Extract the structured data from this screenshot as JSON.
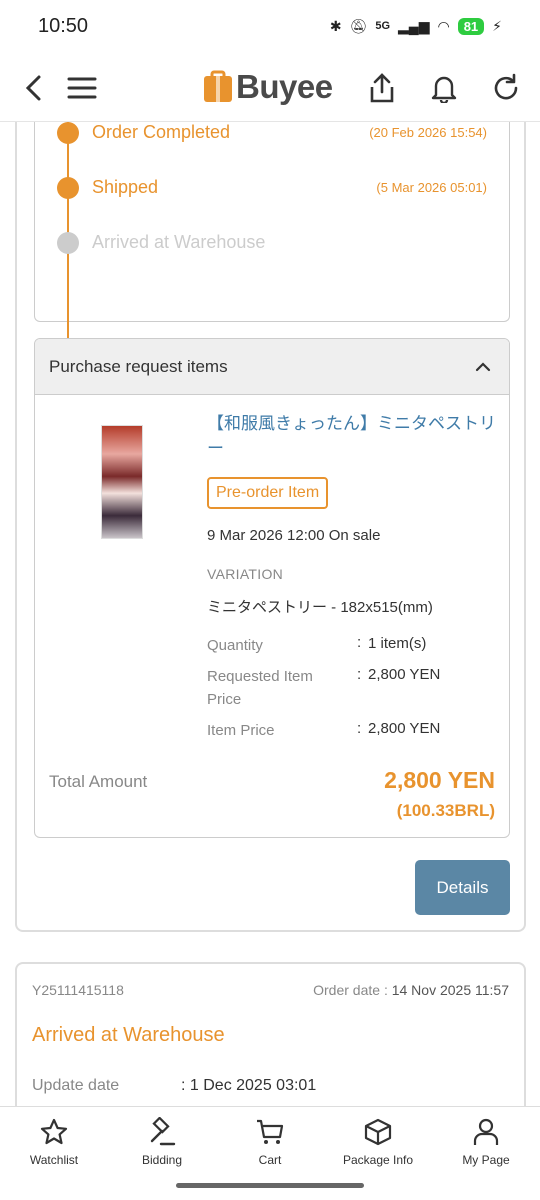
{
  "status": {
    "time": "10:50",
    "battery": "81",
    "network": "5G"
  },
  "header": {
    "logo_text": "Buyee"
  },
  "timeline": [
    {
      "label": "Order Completed",
      "date": "(20 Feb 2026 15:54)"
    },
    {
      "label": "Shipped",
      "date": "(5 Mar 2026 05:01)"
    },
    {
      "label": "Arrived at Warehouse",
      "date": ""
    }
  ],
  "purchase": {
    "heading": "Purchase request items",
    "item_title": "【和服風きょったん】ミニタペストリー",
    "badge": "Pre-order Item",
    "sale_date": "9 Mar 2026 12:00 On sale",
    "variation_label": "VARIATION",
    "variation_value": "ミニタペストリー - 182x515(mm)",
    "rows": [
      {
        "label": "Quantity",
        "colon": ":",
        "value": "1 item(s)"
      },
      {
        "label": "Requested Item Price",
        "colon": ":",
        "value": "2,800 YEN"
      },
      {
        "label": "Item Price",
        "colon": ":",
        "value": "2,800 YEN"
      }
    ],
    "total_label": "Total Amount",
    "total_yen": "2,800 YEN",
    "total_brl": "(100.33BRL)"
  },
  "details_button": "Details",
  "order2": {
    "id": "Y25111415118",
    "order_date_label": "Order date",
    "order_date_sep": ":",
    "order_date": "14 Nov 2025 11:57",
    "status": "Arrived at Warehouse",
    "update_label": "Update date",
    "update_value": ":  1 Dec 2025 03:01"
  },
  "nav": [
    {
      "label": "Watchlist",
      "icon": "star-icon"
    },
    {
      "label": "Bidding",
      "icon": "gavel-icon"
    },
    {
      "label": "Cart",
      "icon": "cart-icon"
    },
    {
      "label": "Package Info",
      "icon": "package-icon"
    },
    {
      "label": "My Page",
      "icon": "person-icon"
    }
  ],
  "colors": {
    "accent": "#e8932e",
    "link": "#3f7ba8",
    "button": "#5b87a5",
    "inactive": "#cccccc"
  }
}
